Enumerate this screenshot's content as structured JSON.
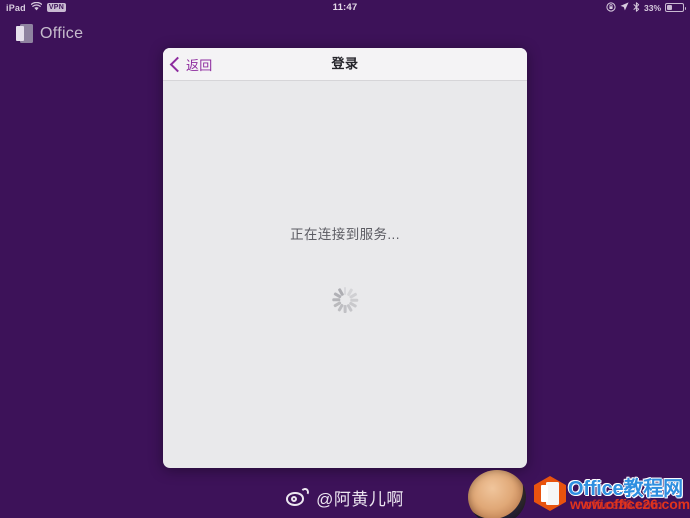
{
  "status_bar": {
    "device_label": "iPad",
    "wifi_icon": "wifi-icon",
    "vpn_badge": "VPN",
    "time": "11:47",
    "rotation_lock_icon": "rotation-lock-icon",
    "location_icon": "location-arrow-icon",
    "bluetooth_icon": "bluetooth-icon",
    "battery_percent": "33%",
    "battery_icon": "battery-icon"
  },
  "home": {
    "brand_label": "Office",
    "brand_icon": "office-logo-icon"
  },
  "login_sheet": {
    "back_label": "返回",
    "back_icon": "chevron-left-icon",
    "title": "登录",
    "status_message": "正在连接到服务...",
    "spinner_icon": "activity-spinner-icon"
  },
  "weibo_credit": {
    "logo_icon": "weibo-logo-icon",
    "handle": "@阿黄儿啊"
  },
  "site_watermark": {
    "avatar_icon": "author-photo",
    "logo_icon": "office-hex-logo-icon",
    "title": "Office教程网",
    "url": "www.office26.com",
    "url_overlay": "office26.com"
  },
  "colors": {
    "background_purple": "#3d1259",
    "accent_purple": "#8d2b9e",
    "sheet_body": "#e9e9eb",
    "sheet_header": "#f4f3f5",
    "watermark_blue": "#2f8fe0",
    "watermark_red": "#e0331d",
    "watermark_orange": "#e8530e"
  }
}
